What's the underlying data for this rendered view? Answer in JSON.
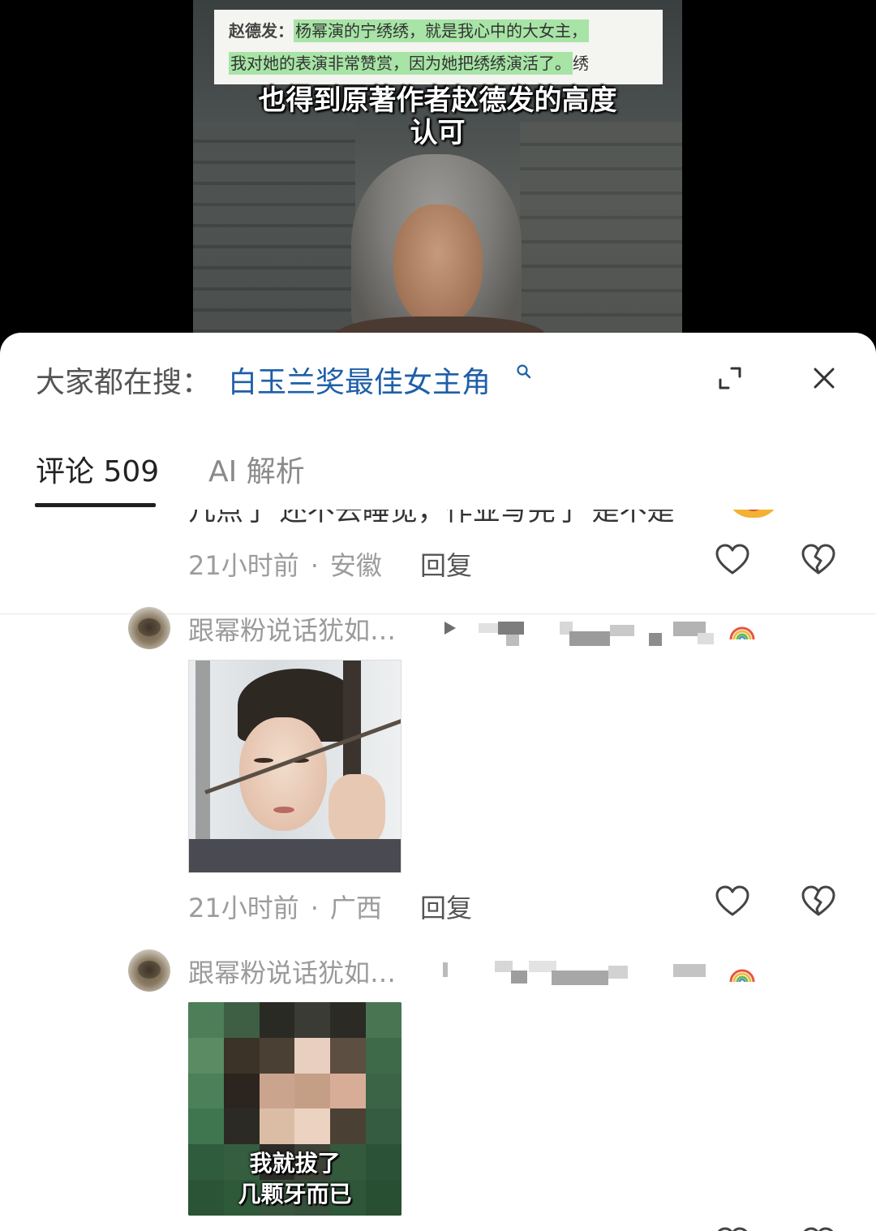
{
  "video": {
    "caption_speaker": "赵德发：",
    "caption_line1": "杨幂演的宁绣绣，就是我心中的大女主，",
    "caption_line2": "我对她的表演非常赞赏，因为她把绣绣演活了。",
    "caption_tail": "绣",
    "subtitle_line1": "也得到原著作者赵德发的高度",
    "subtitle_line2": "认可"
  },
  "sheet": {
    "search_prefix": "大家都在搜：",
    "search_query": "白玉兰奖最佳女主角",
    "search_icon": "search-icon",
    "expand_icon": "expand-icon",
    "close_icon": "close-icon"
  },
  "tabs": [
    {
      "label": "评论 509"
    },
    {
      "label": "AI 解析"
    }
  ],
  "comments": {
    "partial_text": "几点了 还不去睡觉，作业写完了 是不是",
    "first_meta": {
      "time": "21小时前",
      "location": "安徽",
      "reply": "回复"
    },
    "reply1": {
      "username": "跟幂粉说话犹如…",
      "meta": {
        "time": "21小时前",
        "location": "广西",
        "reply": "回复"
      }
    },
    "reply2": {
      "username": "跟幂粉说话犹如…",
      "image_caption_line1": "我就拔了",
      "image_caption_line2": "几颗牙而已"
    },
    "separator": "·"
  },
  "colors": {
    "search_query": "#1e5fa8",
    "caption_highlight": "#a7e4a6",
    "meta_gray": "#9c9c9c"
  }
}
